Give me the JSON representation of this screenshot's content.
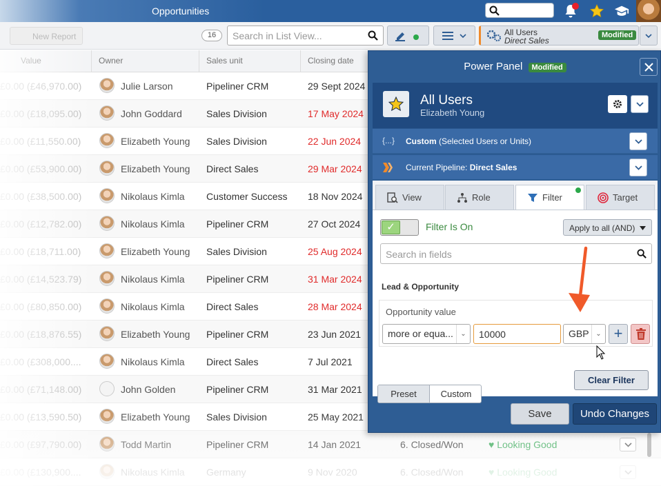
{
  "topbar": {
    "title": "Opportunities"
  },
  "toolbar": {
    "new_report": "New Report",
    "count": "16",
    "search_placeholder": "Search in List View...",
    "profile_name": "All Users",
    "profile_sub": "Direct Sales",
    "profile_badge": "Modified"
  },
  "table": {
    "headers": {
      "value": "Value",
      "owner": "Owner",
      "sales_unit": "Sales unit",
      "closing_date": "Closing date"
    },
    "rows": [
      {
        "value": "£0.00 (£46,970.00)",
        "owner": "Julie Larson",
        "unit": "Pipeliner CRM",
        "date": "29 Sept 2024",
        "overdue": false
      },
      {
        "value": "£0.00 (£18,095.00)",
        "owner": "John Goddard",
        "unit": "Sales Division",
        "date": "17 May 2024",
        "overdue": true
      },
      {
        "value": "£0.00 (£11,550.00)",
        "owner": "Elizabeth Young",
        "unit": "Sales Division",
        "date": "22 Jun 2024",
        "overdue": true
      },
      {
        "value": "£0.00 (£53,900.00)",
        "owner": "Elizabeth Young",
        "unit": "Direct Sales",
        "date": "29 Mar 2024",
        "overdue": true
      },
      {
        "value": "£0.00 (£38,500.00)",
        "owner": "Nikolaus Kimla",
        "unit": "Customer Success",
        "date": "18 Nov 2024",
        "overdue": false
      },
      {
        "value": "£0.00 (£12,782.00)",
        "owner": "Nikolaus Kimla",
        "unit": "Pipeliner CRM",
        "date": "27 Oct 2024",
        "overdue": false
      },
      {
        "value": "£0.00 (£18,711.00)",
        "owner": "Elizabeth Young",
        "unit": "Sales Division",
        "date": "25 Aug 2024",
        "overdue": true
      },
      {
        "value": "£0.00 (£14,523.79)",
        "owner": "Nikolaus Kimla",
        "unit": "Pipeliner CRM",
        "date": "31 Mar 2024",
        "overdue": true
      },
      {
        "value": "£0.00 (£80,850.00)",
        "owner": "Nikolaus Kimla",
        "unit": "Direct Sales",
        "date": "28 Mar 2024",
        "overdue": true
      },
      {
        "value": "£0.00 (£18,876.55)",
        "owner": "Elizabeth Young",
        "unit": "Pipeliner CRM",
        "date": "23 Jun 2021",
        "overdue": false
      },
      {
        "value": "£0.00 (£308,000....",
        "owner": "Nikolaus Kimla",
        "unit": "Direct Sales",
        "date": "7 Jul 2021",
        "overdue": false
      },
      {
        "value": "£0.00 (£71,148.00)",
        "owner": "John Golden",
        "unit": "Pipeliner CRM",
        "date": "31 Mar 2021",
        "overdue": false,
        "generic_avatar": true
      },
      {
        "value": "£0.00 (£13,590.50)",
        "owner": "Elizabeth Young",
        "unit": "Sales Division",
        "date": "25 May 2021",
        "overdue": false
      },
      {
        "value": "£0.00 (£97,790.00)",
        "owner": "Todd Martin",
        "unit": "Pipeliner CRM",
        "date": "14 Jan 2021",
        "overdue": false,
        "stage": "6. Closed/Won",
        "health": "Looking Good"
      },
      {
        "value": "£0.00 (£130,900....",
        "owner": "Nikolaus Kimla",
        "unit": "Germany",
        "date": "9 Nov 2020",
        "overdue": false,
        "stage": "6. Closed/Won",
        "health": "Looking Good"
      }
    ]
  },
  "panel": {
    "title": "Power Panel",
    "badge": "Modified",
    "profile_title": "All Users",
    "profile_sub": "Elizabeth Young",
    "custom_bold": "Custom",
    "custom_rest": " (Selected Users or Units)",
    "pipeline_label": "Current Pipeline: ",
    "pipeline_value": "Direct Sales",
    "tabs": [
      "View",
      "Role",
      "Filter",
      "Target"
    ],
    "filter_state": "Filter Is On",
    "apply_label": "Apply to all (AND)",
    "search_placeholder": "Search in fields",
    "section": "Lead & Opportunity",
    "field_label": "Opportunity value",
    "operator": "more or equa...",
    "amount": "10000",
    "currency": "GBP",
    "preset": "Preset",
    "custom": "Custom",
    "clear": "Clear Filter",
    "save": "Save",
    "undo": "Undo Changes"
  },
  "colors": {
    "brand_blue": "#2e5d94",
    "modified_green": "#3a8a3f",
    "overdue_red": "#e02a2a",
    "accent_orange": "#f05a2a"
  }
}
